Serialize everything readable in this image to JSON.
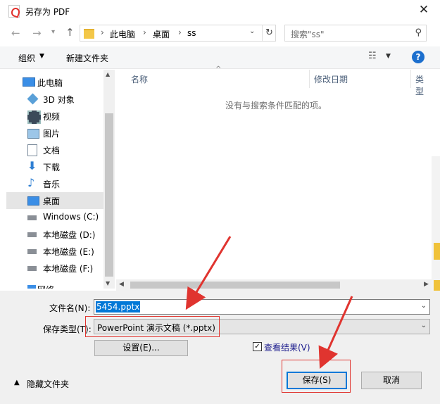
{
  "window": {
    "title": "另存为 PDF"
  },
  "nav_bar": {
    "breadcrumbs": [
      "此电脑",
      "桌面",
      "ss"
    ],
    "search_placeholder": "搜索\"ss\""
  },
  "toolbar": {
    "organize_label": "组织",
    "new_folder_label": "新建文件夹",
    "help_label": "?"
  },
  "sidebar": {
    "items": [
      {
        "label": "此电脑",
        "icon": "computer-icon"
      },
      {
        "label": "3D 对象",
        "icon": "cube-icon"
      },
      {
        "label": "视频",
        "icon": "video-icon"
      },
      {
        "label": "图片",
        "icon": "picture-icon"
      },
      {
        "label": "文档",
        "icon": "document-icon"
      },
      {
        "label": "下载",
        "icon": "download-icon"
      },
      {
        "label": "音乐",
        "icon": "music-icon"
      },
      {
        "label": "桌面",
        "icon": "desktop-icon",
        "selected": true
      },
      {
        "label": "Windows (C:)",
        "icon": "drive-icon"
      },
      {
        "label": "本地磁盘 (D:)",
        "icon": "drive-icon"
      },
      {
        "label": "本地磁盘 (E:)",
        "icon": "drive-icon"
      },
      {
        "label": "本地磁盘 (F:)",
        "icon": "drive-icon"
      },
      {
        "label": "网络",
        "icon": "network-icon"
      }
    ]
  },
  "file_list": {
    "columns": [
      "名称",
      "修改日期",
      "类型"
    ],
    "empty_message": "没有与搜索条件匹配的项。"
  },
  "form": {
    "filename_label": "文件名(N):",
    "filename_value": "5454.pptx",
    "filetype_label": "保存类型(T):",
    "filetype_value": "PowerPoint 演示文稿 (*.pptx)",
    "settings_label": "设置(E)...",
    "view_result_label": "查看结果(V)",
    "view_result_checked": true
  },
  "footer": {
    "hide_folders_label": "隐藏文件夹",
    "save_label": "保存(S)",
    "cancel_label": "取消"
  },
  "colors": {
    "accent": "#0078d7",
    "annotation": "#e0342f",
    "selection": "#e5e5e5"
  }
}
